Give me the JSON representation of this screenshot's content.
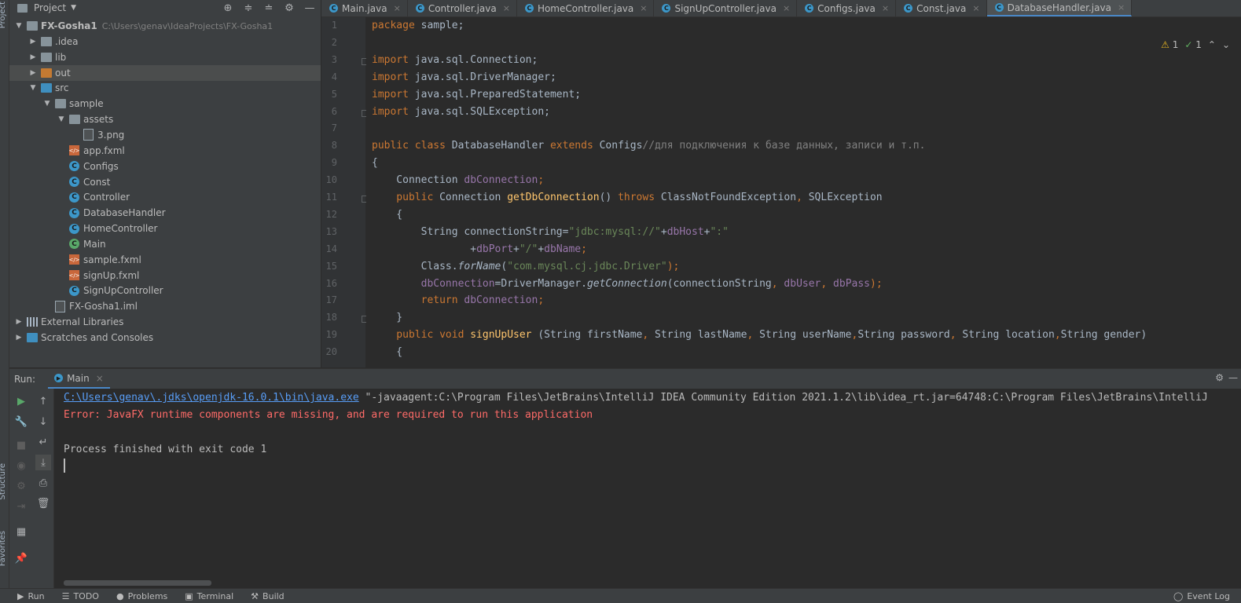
{
  "project_panel": {
    "title": "Project",
    "tree": [
      {
        "label": "FX-Gosha1",
        "path": "C:\\Users\\genav\\IdeaProjects\\FX-Gosha1",
        "depth": 0,
        "expanded": true,
        "icon": "folder-icon"
      },
      {
        "label": ".idea",
        "depth": 1,
        "expanded": false,
        "icon": "folder-icon"
      },
      {
        "label": "lib",
        "depth": 1,
        "expanded": false,
        "icon": "folder-icon"
      },
      {
        "label": "out",
        "depth": 1,
        "expanded": false,
        "icon": "folder-orange-icon",
        "selected": true
      },
      {
        "label": "src",
        "depth": 1,
        "expanded": true,
        "icon": "folder-blue-icon"
      },
      {
        "label": "sample",
        "depth": 2,
        "expanded": true,
        "icon": "package-icon"
      },
      {
        "label": "assets",
        "depth": 3,
        "expanded": true,
        "icon": "package-icon"
      },
      {
        "label": "3.png",
        "depth": 4,
        "icon": "image-file-icon"
      },
      {
        "label": "app.fxml",
        "depth": 3,
        "icon": "fxml-file-icon"
      },
      {
        "label": "Configs",
        "depth": 3,
        "icon": "java-class-icon"
      },
      {
        "label": "Const",
        "depth": 3,
        "icon": "java-class-icon"
      },
      {
        "label": "Controller",
        "depth": 3,
        "icon": "java-class-icon"
      },
      {
        "label": "DatabaseHandler",
        "depth": 3,
        "icon": "java-class-icon"
      },
      {
        "label": "HomeController",
        "depth": 3,
        "icon": "java-class-icon"
      },
      {
        "label": "Main",
        "depth": 3,
        "icon": "java-main-class-icon"
      },
      {
        "label": "sample.fxml",
        "depth": 3,
        "icon": "fxml-file-icon"
      },
      {
        "label": "signUp.fxml",
        "depth": 3,
        "icon": "fxml-file-icon"
      },
      {
        "label": "SignUpController",
        "depth": 3,
        "icon": "java-class-icon"
      },
      {
        "label": "FX-Gosha1.iml",
        "depth": 2,
        "icon": "iml-file-icon"
      },
      {
        "label": "External Libraries",
        "depth": 0,
        "expanded": false,
        "icon": "library-icon"
      },
      {
        "label": "Scratches and Consoles",
        "depth": 0,
        "expanded": false,
        "icon": "scratches-icon"
      }
    ]
  },
  "left_strip": {
    "project_label": "Project",
    "structure_label": "Structure",
    "favorites_label": "Favorites"
  },
  "tabs": [
    {
      "label": "Main.java",
      "active": false
    },
    {
      "label": "Controller.java",
      "active": false
    },
    {
      "label": "HomeController.java",
      "active": false
    },
    {
      "label": "SignUpController.java",
      "active": false
    },
    {
      "label": "Configs.java",
      "active": false
    },
    {
      "label": "Const.java",
      "active": false
    },
    {
      "label": "DatabaseHandler.java",
      "active": true
    }
  ],
  "editor_status": {
    "warnings": "1",
    "checks": "1"
  },
  "code": {
    "line_numbers": [
      "1",
      "2",
      "3",
      "4",
      "5",
      "6",
      "7",
      "8",
      "9",
      "10",
      "11",
      "12",
      "13",
      "14",
      "15",
      "16",
      "17",
      "18",
      "19",
      "20"
    ],
    "lines": [
      [
        {
          "t": "package ",
          "c": "kw"
        },
        {
          "t": "sample;"
        }
      ],
      [],
      [
        {
          "t": "import ",
          "c": "kw"
        },
        {
          "t": "java.sql.Connection;"
        }
      ],
      [
        {
          "t": "import ",
          "c": "kw"
        },
        {
          "t": "java.sql.DriverManager;"
        }
      ],
      [
        {
          "t": "import ",
          "c": "kw"
        },
        {
          "t": "java.sql.PreparedStatement;"
        }
      ],
      [
        {
          "t": "import ",
          "c": "kw"
        },
        {
          "t": "java.sql.SQLException;"
        }
      ],
      [],
      [
        {
          "t": "public class ",
          "c": "kw"
        },
        {
          "t": "DatabaseHandler "
        },
        {
          "t": "extends ",
          "c": "kw"
        },
        {
          "t": "Configs"
        },
        {
          "t": "//для подключения к базе данных, записи и т.п.",
          "c": "cm"
        }
      ],
      [
        {
          "t": "{"
        }
      ],
      [
        {
          "t": "    Connection "
        },
        {
          "t": "dbConnection",
          "c": "fld"
        },
        {
          "t": ";",
          "c": "kw"
        }
      ],
      [
        {
          "t": "    public ",
          "c": "kw"
        },
        {
          "t": "Connection "
        },
        {
          "t": "getDbConnection",
          "c": "fn"
        },
        {
          "t": "() "
        },
        {
          "t": "throws ",
          "c": "kw"
        },
        {
          "t": "ClassNotFoundException"
        },
        {
          "t": ", ",
          "c": "kw"
        },
        {
          "t": "SQLException"
        }
      ],
      [
        {
          "t": "    {"
        }
      ],
      [
        {
          "t": "        String connectionString="
        },
        {
          "t": "\"jdbc:mysql://\"",
          "c": "st"
        },
        {
          "t": "+"
        },
        {
          "t": "dbHost",
          "c": "fld"
        },
        {
          "t": "+"
        },
        {
          "t": "\":\"",
          "c": "st"
        }
      ],
      [
        {
          "t": "                +"
        },
        {
          "t": "dbPort",
          "c": "fld"
        },
        {
          "t": "+"
        },
        {
          "t": "\"/\"",
          "c": "st"
        },
        {
          "t": "+"
        },
        {
          "t": "dbName",
          "c": "fld"
        },
        {
          "t": ";",
          "c": "kw"
        }
      ],
      [
        {
          "t": "        Class."
        },
        {
          "t": "forName",
          "c": "it"
        },
        {
          "t": "("
        },
        {
          "t": "\"com.mysql.cj.jdbc.Driver\"",
          "c": "st"
        },
        {
          "t": ");",
          "c": "kw"
        }
      ],
      [
        {
          "t": "        "
        },
        {
          "t": "dbConnection",
          "c": "fld"
        },
        {
          "t": "=DriverManager."
        },
        {
          "t": "getConnection",
          "c": "it"
        },
        {
          "t": "(connectionString"
        },
        {
          "t": ", ",
          "c": "kw"
        },
        {
          "t": "dbUser",
          "c": "fld"
        },
        {
          "t": ", ",
          "c": "kw"
        },
        {
          "t": "dbPass",
          "c": "fld"
        },
        {
          "t": ");",
          "c": "kw"
        }
      ],
      [
        {
          "t": "        return ",
          "c": "kw"
        },
        {
          "t": "dbConnection",
          "c": "fld"
        },
        {
          "t": ";",
          "c": "kw"
        }
      ],
      [
        {
          "t": "    }"
        }
      ],
      [
        {
          "t": "    public void ",
          "c": "kw"
        },
        {
          "t": "signUpUser ",
          "c": "fn"
        },
        {
          "t": "(String firstName"
        },
        {
          "t": ", ",
          "c": "kw"
        },
        {
          "t": "String lastName"
        },
        {
          "t": ", ",
          "c": "kw"
        },
        {
          "t": "String userName"
        },
        {
          "t": ",",
          "c": "kw"
        },
        {
          "t": "String password"
        },
        {
          "t": ", ",
          "c": "kw"
        },
        {
          "t": "String location"
        },
        {
          "t": ",",
          "c": "kw"
        },
        {
          "t": "String gender)"
        }
      ],
      [
        {
          "t": "    {"
        }
      ]
    ]
  },
  "run_panel": {
    "label": "Run:",
    "tab": "Main",
    "console": {
      "java_path": "C:\\Users\\genav\\.jdks\\openjdk-16.0.1\\bin\\java.exe",
      "java_args": " \"-javaagent:C:\\Program Files\\JetBrains\\IntelliJ IDEA Community Edition 2021.1.2\\lib\\idea_rt.jar=64748:C:\\Program Files\\JetBrains\\IntelliJ",
      "error_line": "Error: JavaFX runtime components are missing, and are required to run this application",
      "exit_line": "Process finished with exit code 1"
    }
  },
  "bottom_bar": {
    "run": "Run",
    "todo": "TODO",
    "problems": "Problems",
    "terminal": "Terminal",
    "build": "Build",
    "event_log": "Event Log"
  }
}
